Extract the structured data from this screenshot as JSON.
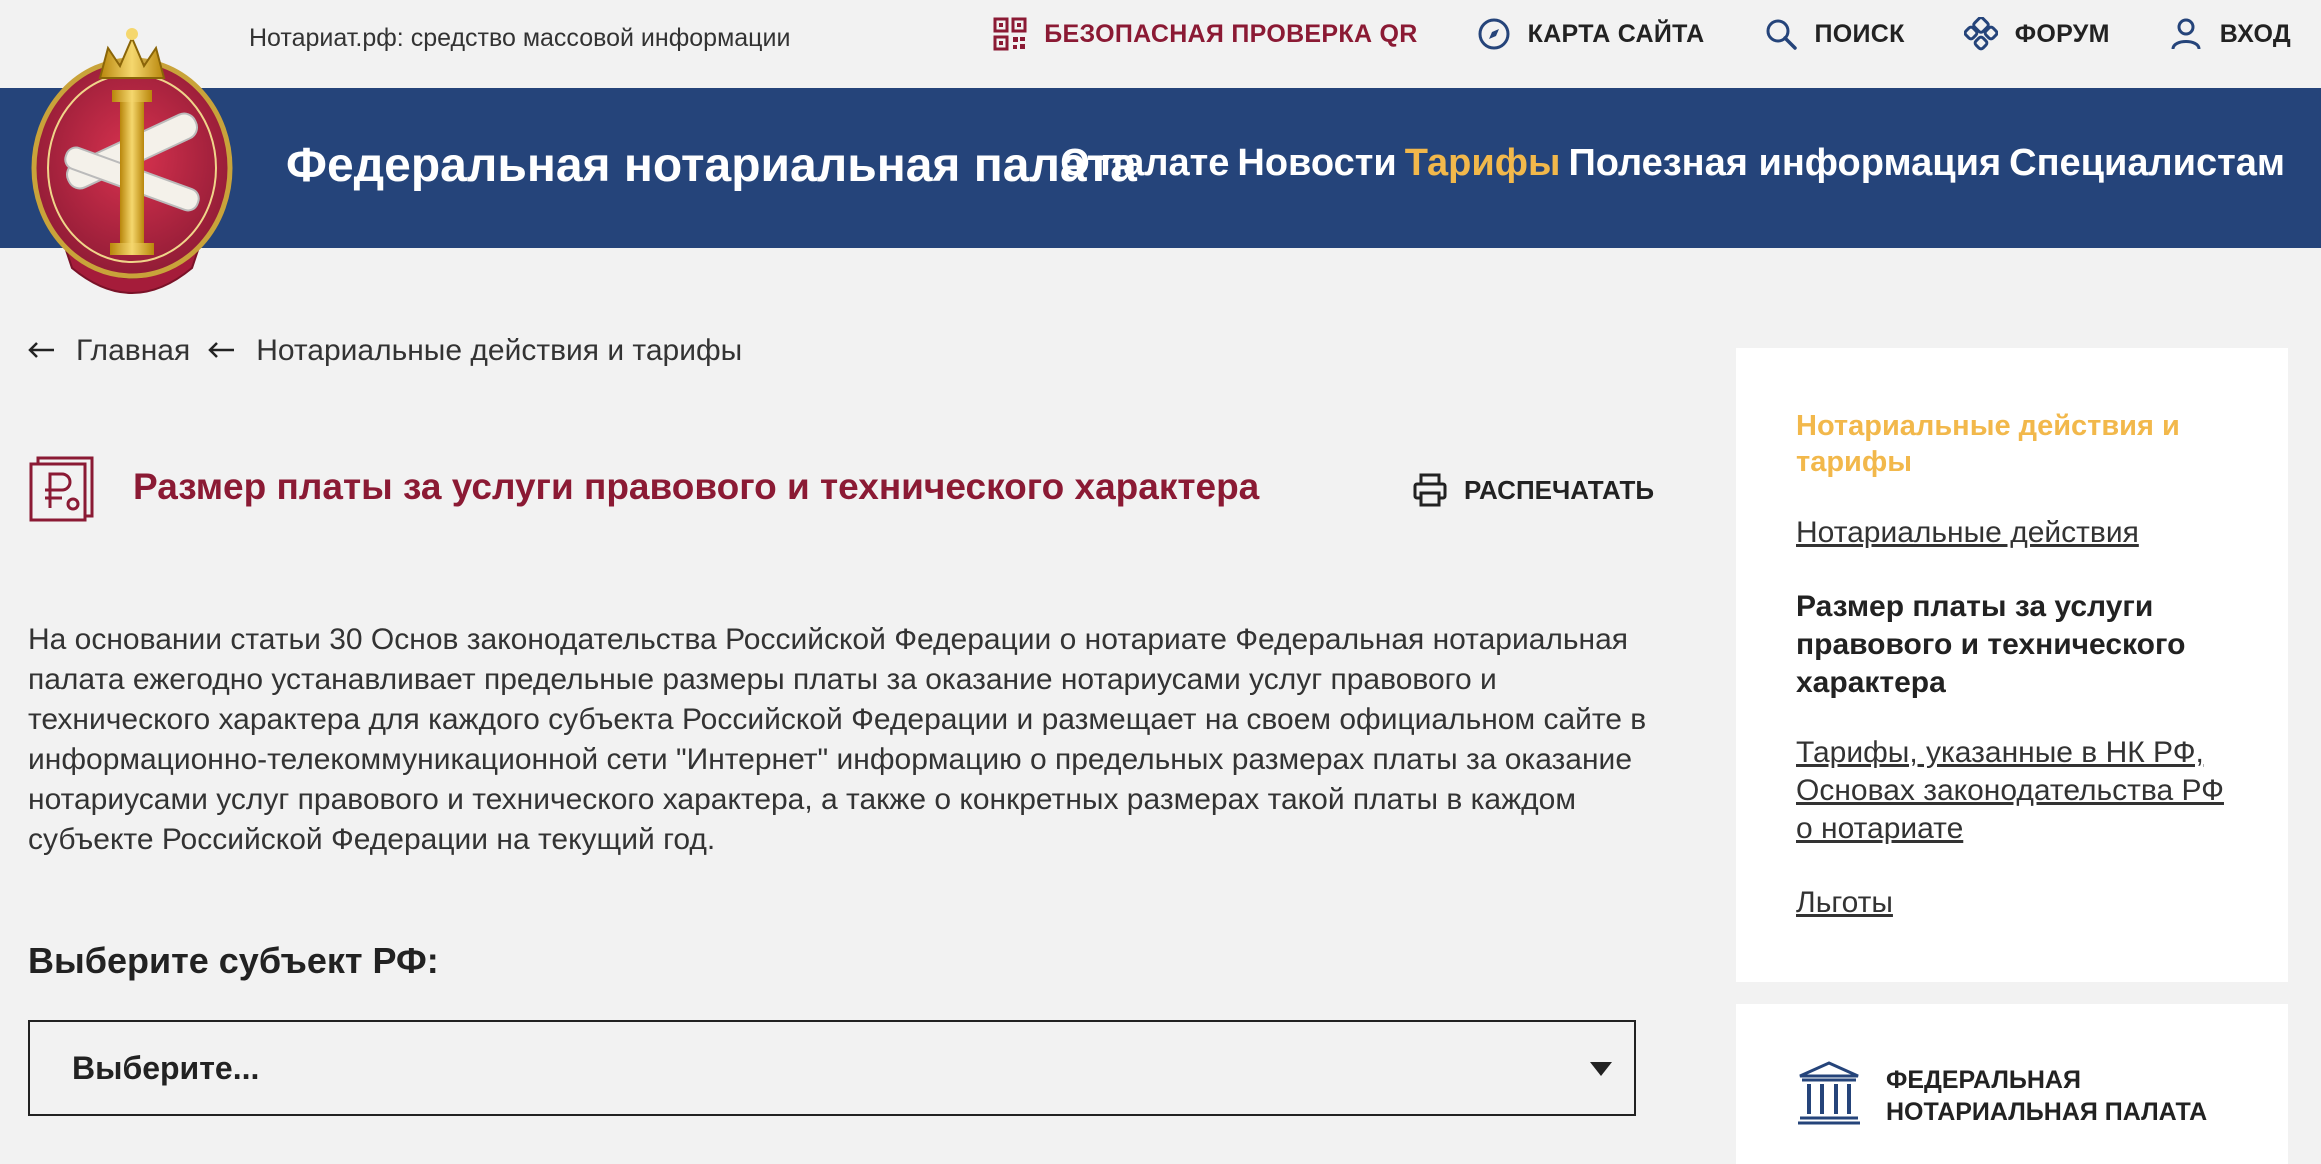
{
  "topbar": {
    "media_note": "Нотариат.рф: средство массовой информации",
    "links": [
      {
        "label": "БЕЗОПАСНАЯ ПРОВЕРКА QR",
        "icon": "qr-code-icon"
      },
      {
        "label": "КАРТА САЙТА",
        "icon": "compass-icon"
      },
      {
        "label": "ПОИСК",
        "icon": "search-icon"
      },
      {
        "label": "ФОРУМ",
        "icon": "forum-icon"
      },
      {
        "label": "ВХОД",
        "icon": "user-icon"
      }
    ]
  },
  "header": {
    "site_title": "Федеральная нотариальная палата",
    "nav": [
      {
        "label": "О палате",
        "active": false
      },
      {
        "label": "Новости",
        "active": false
      },
      {
        "label": "Тарифы",
        "active": true
      },
      {
        "label": "Полезная информация",
        "active": false
      },
      {
        "label": "Специалистам",
        "active": false
      }
    ]
  },
  "breadcrumb": [
    "Главная",
    "Нотариальные действия и тарифы"
  ],
  "page": {
    "title": "Размер платы за услуги правового и технического характера",
    "print_label": "РАСПЕЧАТАТЬ",
    "intro": "На основании статьи 30 Основ законодательства Российской Федерации о нотариате Федеральная нотариальная палата ежегодно устанавливает предельные размеры платы за оказание нотариусами услуг правового и технического характера для каждого субъекта Российской Федерации и размещает на своем официальном сайте в информационно-телекоммуникационной сети \"Интернет\" информацию о предельных размерах платы за оказание нотариусами услуг правового и технического характера, а также о конкретных размерах такой платы в каждом субъекте Российской Федерации на текущий год.",
    "select_label": "Выберите субъект РФ:",
    "select_value": "Выберите..."
  },
  "sidebar": {
    "heading": "Нотариальные действия и тарифы",
    "items": [
      {
        "label": "Нотариальные действия ",
        "current": false
      },
      {
        "label": "Размер платы за услуги правового и технического характера",
        "current": true
      },
      {
        "label": "Тарифы, указанные в НК РФ, Основах законодательства РФ о нотариате",
        "current": false
      },
      {
        "label": "Льготы",
        "current": false
      }
    ],
    "card_title": "ФЕДЕРАЛЬНАЯ НОТАРИАЛЬНАЯ ПАЛАТА"
  },
  "colors": {
    "header_blue": "#25447a",
    "accent_red": "#8b1a34",
    "accent_gold": "#f2b84b",
    "background": "#f2f2f2"
  }
}
